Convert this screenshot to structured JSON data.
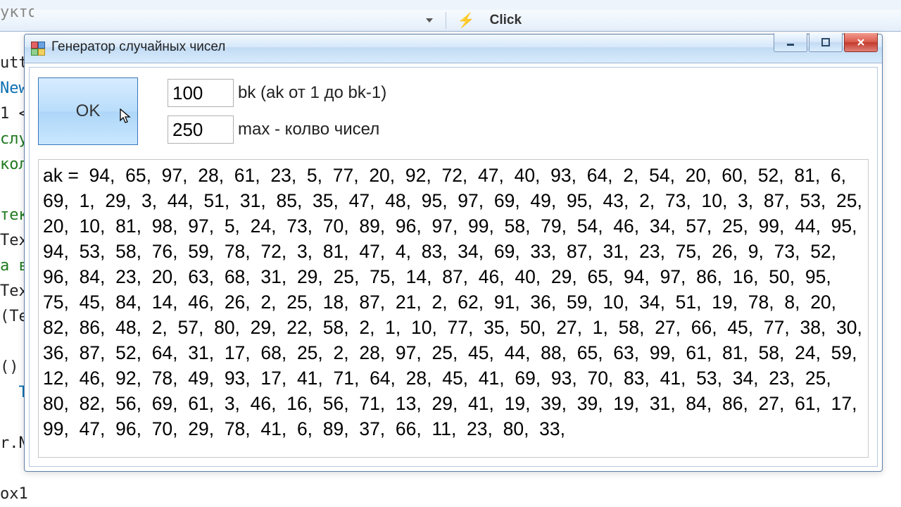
{
  "background_code": [
    {
      "t": "уктор]",
      "c": "tk-gray"
    },
    {
      "t": "",
      "c": ""
    },
    {
      "t": "utt",
      "c": "tk-blk"
    },
    {
      "t": "New",
      "c": "tk-blue"
    },
    {
      "t": "1 <",
      "c": "tk-blk"
    },
    {
      "t": "слу",
      "c": "tk-green"
    },
    {
      "t": "кол",
      "c": "tk-green"
    },
    {
      "t": "",
      "c": ""
    },
    {
      "t": "тек",
      "c": "tk-green"
    },
    {
      "t": "Tex",
      "c": "tk-blk"
    },
    {
      "t": "а в",
      "c": "tk-green"
    },
    {
      "t": "Tex",
      "c": "tk-blk"
    },
    {
      "t": "(Te",
      "c": "tk-blk"
    },
    {
      "t": "",
      "c": ""
    },
    {
      "t": "()",
      "c": "tk-blk"
    },
    {
      "t": "  To",
      "c": "tk-blue"
    },
    {
      "t": "",
      "c": ""
    },
    {
      "t": "r.N",
      "c": "tk-blk"
    },
    {
      "t": "",
      "c": ""
    },
    {
      "t": "ox1",
      "c": "tk-blk"
    }
  ],
  "toolbar": {
    "event_name": "Click"
  },
  "window": {
    "title": "Генератор случайных чисел",
    "buttons": {
      "min": "",
      "max": "",
      "close": "X"
    }
  },
  "form": {
    "ok_label": "OK",
    "bk_value": "100",
    "bk_label": "bk  (ak от 1 до bk-1)",
    "max_value": "250",
    "max_label": "max - колво чисел"
  },
  "output_prefix": "ak = ",
  "output_values": [
    94,
    65,
    97,
    28,
    61,
    23,
    5,
    77,
    20,
    92,
    72,
    47,
    40,
    93,
    64,
    2,
    54,
    20,
    60,
    52,
    81,
    6,
    69,
    1,
    29,
    3,
    44,
    51,
    31,
    85,
    35,
    47,
    48,
    95,
    97,
    69,
    49,
    95,
    43,
    2,
    73,
    10,
    3,
    87,
    53,
    25,
    20,
    10,
    81,
    98,
    97,
    5,
    24,
    73,
    70,
    89,
    96,
    97,
    99,
    58,
    79,
    54,
    46,
    34,
    57,
    25,
    99,
    44,
    95,
    94,
    53,
    58,
    76,
    59,
    78,
    72,
    3,
    81,
    47,
    4,
    83,
    34,
    69,
    33,
    87,
    31,
    23,
    75,
    26,
    9,
    73,
    52,
    96,
    84,
    23,
    20,
    63,
    68,
    31,
    29,
    25,
    75,
    14,
    87,
    46,
    40,
    29,
    65,
    94,
    97,
    86,
    16,
    50,
    95,
    75,
    45,
    84,
    14,
    46,
    26,
    2,
    25,
    18,
    87,
    21,
    2,
    62,
    91,
    36,
    59,
    10,
    34,
    51,
    19,
    78,
    8,
    20,
    82,
    86,
    48,
    2,
    57,
    80,
    29,
    22,
    58,
    2,
    1,
    10,
    77,
    35,
    50,
    27,
    1,
    58,
    27,
    66,
    45,
    77,
    38,
    30,
    36,
    87,
    52,
    64,
    31,
    17,
    68,
    25,
    2,
    28,
    97,
    25,
    45,
    44,
    88,
    65,
    63,
    99,
    61,
    81,
    58,
    24,
    59,
    12,
    46,
    92,
    78,
    49,
    93,
    17,
    41,
    71,
    64,
    28,
    45,
    41,
    69,
    93,
    70,
    83,
    41,
    53,
    34,
    23,
    25,
    80,
    82,
    56,
    69,
    61,
    3,
    46,
    16,
    56,
    71,
    13,
    29,
    41,
    19,
    39,
    39,
    19,
    31,
    84,
    86,
    27,
    61,
    17,
    99,
    47,
    96,
    70,
    29,
    78,
    41,
    6,
    89,
    37,
    66,
    11,
    23,
    80,
    33
  ]
}
